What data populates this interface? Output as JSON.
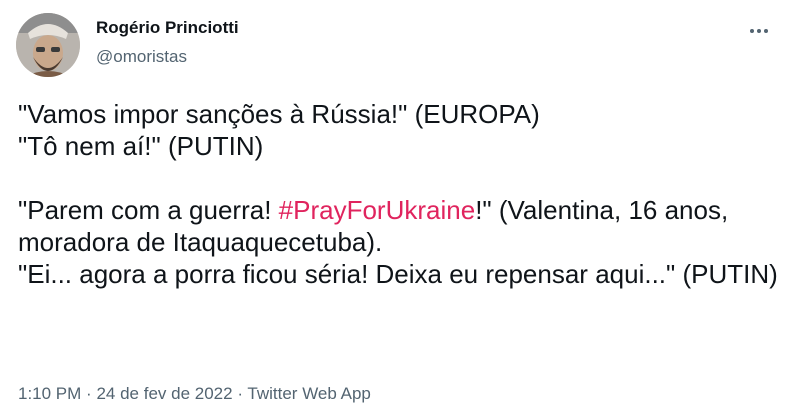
{
  "author": {
    "name": "Rogério Princiotti",
    "handle": "@omoristas"
  },
  "tweet": {
    "line1": "\"Vamos impor sanções à Rússia!\" (EUROPA)",
    "line2": "\"Tô nem aí!\" (PUTIN)",
    "line3_prefix": "\"Parem com a guerra! ",
    "hashtag": "#PrayForUkraine",
    "line3_suffix": "!\" (Valentina, 16 anos, moradora de Itaquaquecetuba).",
    "line4": "\"Ei... agora a porra ficou séria! Deixa eu repensar aqui...\" (PUTIN)"
  },
  "meta": {
    "time": "1:10 PM",
    "date": "24 de fev de 2022",
    "source": "Twitter Web App",
    "separator": "·"
  },
  "colors": {
    "text": "#0f1419",
    "secondary": "#536471",
    "hashtag": "#e0245e"
  },
  "icons": {
    "more": "more-horizontal-icon"
  }
}
